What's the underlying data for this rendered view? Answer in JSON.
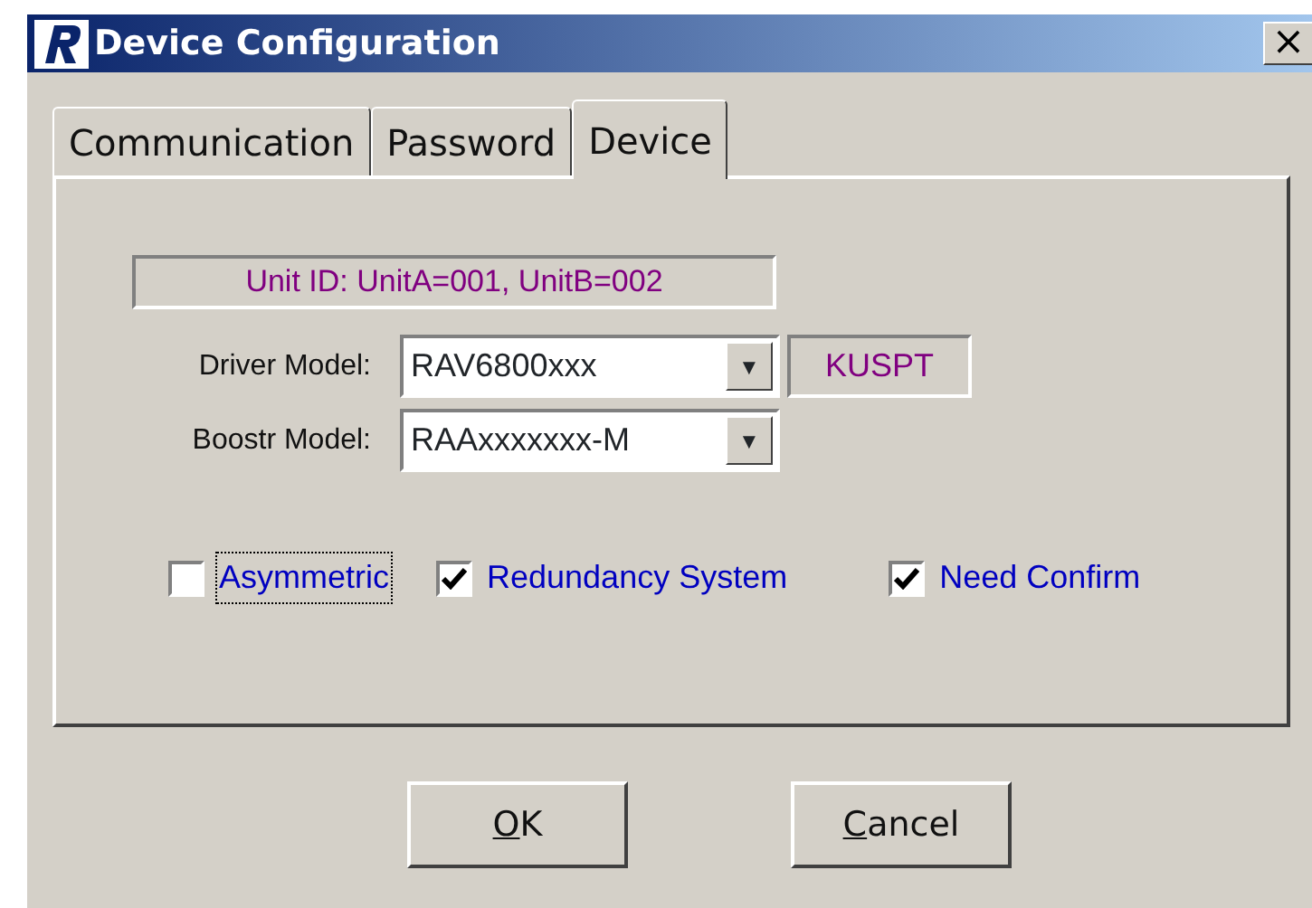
{
  "window": {
    "title": "Device Configuration",
    "close": "×"
  },
  "tabs": [
    {
      "label": "Communication",
      "selected": false
    },
    {
      "label": "Password",
      "selected": false
    },
    {
      "label": "Device",
      "selected": true
    }
  ],
  "unit_id": "Unit ID: UnitA=001, UnitB=002",
  "fields": [
    {
      "label": "Driver Model:",
      "value": "RAV6800xxx",
      "caret": "▼",
      "badge": "KUSPT"
    },
    {
      "label": "Boostr Model:",
      "value": "RAAxxxxxxx-M",
      "caret": "▼"
    }
  ],
  "options": [
    {
      "label": "Asymmetric",
      "checked": false,
      "focused": true
    },
    {
      "label": "Redundancy System",
      "checked": true,
      "focused": false
    },
    {
      "label": "Need Confirm",
      "checked": true,
      "focused": false
    }
  ],
  "buttons": [
    {
      "label": "OK",
      "mnemonic_underlined": true
    },
    {
      "label": "Cancel",
      "mnemonic_underlined": true
    }
  ]
}
